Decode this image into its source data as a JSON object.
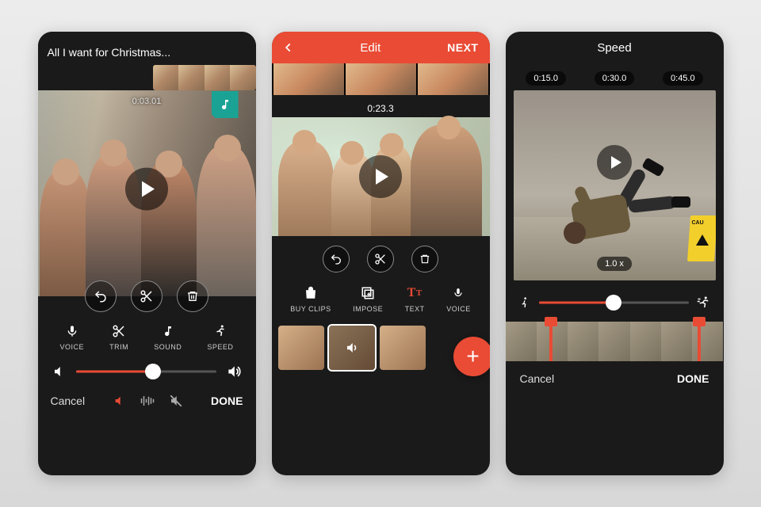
{
  "screen1": {
    "title": "All I want for Christmas...",
    "time": "0:03.01",
    "tools": {
      "voice": "VOICE",
      "trim": "TRIM",
      "sound": "SOUND",
      "speed": "SPEED"
    },
    "volume_percent": 55,
    "cancel": "Cancel",
    "done": "DONE"
  },
  "screen2": {
    "header": {
      "title": "Edit",
      "next": "NEXT"
    },
    "time": "0:23.3",
    "tools": {
      "buy_clips": "BUY CLIPS",
      "impose": "IMPOSE",
      "text": "TEXT",
      "voice": "VOICE"
    }
  },
  "screen3": {
    "title": "Speed",
    "marks": {
      "t1": "0:15.0",
      "t2": "0:30.0",
      "t3": "0:45.0"
    },
    "speed_label": "1.0 x",
    "slider_percent": 50,
    "caution": "CAU",
    "cancel": "Cancel",
    "done": "DONE"
  },
  "colors": {
    "accent": "#e94b35",
    "teal": "#1aa394"
  }
}
